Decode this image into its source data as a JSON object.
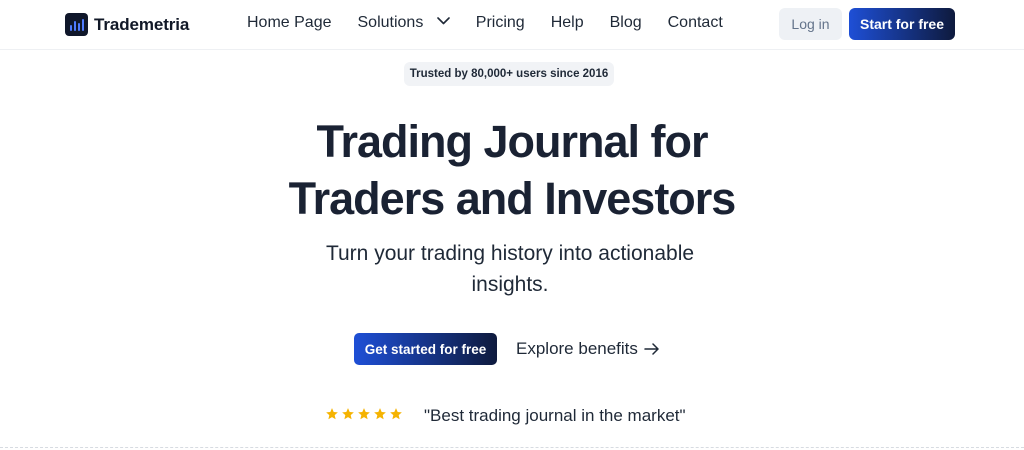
{
  "header": {
    "logo_text": "Trademetria",
    "nav": [
      {
        "label": "Home Page"
      },
      {
        "label": "Solutions"
      },
      {
        "label": "Pricing"
      },
      {
        "label": "Help"
      },
      {
        "label": "Blog"
      },
      {
        "label": "Contact"
      }
    ],
    "login_label": "Log in",
    "start_label": "Start for free"
  },
  "hero": {
    "badge": "Trusted by 80,000+ users since 2016",
    "headline_line1": "Trading Journal for",
    "headline_line2": "Traders and Investors",
    "subhead": "Turn your trading history into actionable insights.",
    "cta_primary": "Get started for free",
    "cta_secondary": "Explore benefits",
    "rating_stars": 5,
    "quote": "\"Best trading journal in the market\""
  },
  "colors": {
    "brand_blue": "#1e4fd6",
    "brand_dark": "#0e1a3d",
    "star": "#f5b301"
  },
  "icons": {
    "nav_dropdown": "chevron-down-icon",
    "cta_arrow": "arrow-right-icon",
    "rating": "star-icon"
  }
}
